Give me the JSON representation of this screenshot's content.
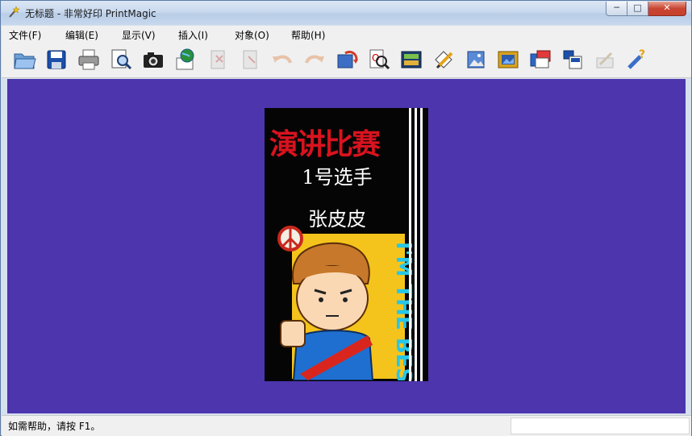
{
  "window": {
    "title": "无标题 - 非常好印 PrintMagic",
    "controls": {
      "minimize": "─",
      "maximize": "□",
      "close": "✕"
    }
  },
  "menu": [
    {
      "label": "文件(F)"
    },
    {
      "label": "编辑(E)"
    },
    {
      "label": "显示(V)"
    },
    {
      "label": "插入(I)"
    },
    {
      "label": "对象(O)"
    },
    {
      "label": "帮助(H)"
    }
  ],
  "toolbar": [
    {
      "icon": "open-folder-icon"
    },
    {
      "icon": "save-icon"
    },
    {
      "icon": "print-icon"
    },
    {
      "icon": "print-preview-icon"
    },
    {
      "icon": "camera-icon"
    },
    {
      "icon": "web-icon"
    },
    {
      "icon": "cut-icon",
      "disabled": true
    },
    {
      "icon": "copy-icon",
      "disabled": true
    },
    {
      "icon": "undo-icon",
      "disabled": true
    },
    {
      "icon": "redo-icon",
      "disabled": true
    },
    {
      "icon": "rotate-icon"
    },
    {
      "icon": "zoom-icon"
    },
    {
      "icon": "text-icon"
    },
    {
      "icon": "draw-icon"
    },
    {
      "icon": "insert-image-icon"
    },
    {
      "icon": "frame-icon"
    },
    {
      "icon": "photo-icon"
    },
    {
      "icon": "layout-icon"
    },
    {
      "icon": "settings-icon",
      "disabled": true
    },
    {
      "icon": "help-icon"
    }
  ],
  "card": {
    "title": "演讲比赛",
    "number": "1号选手",
    "name": "张皮皮",
    "banner": "I'M THE BEST",
    "colors": {
      "background": "#050505",
      "title": "#d8131f",
      "text": "#ffffff",
      "canvas": "#4c35ad"
    }
  },
  "status": {
    "text": "如需帮助，请按 F1。"
  }
}
